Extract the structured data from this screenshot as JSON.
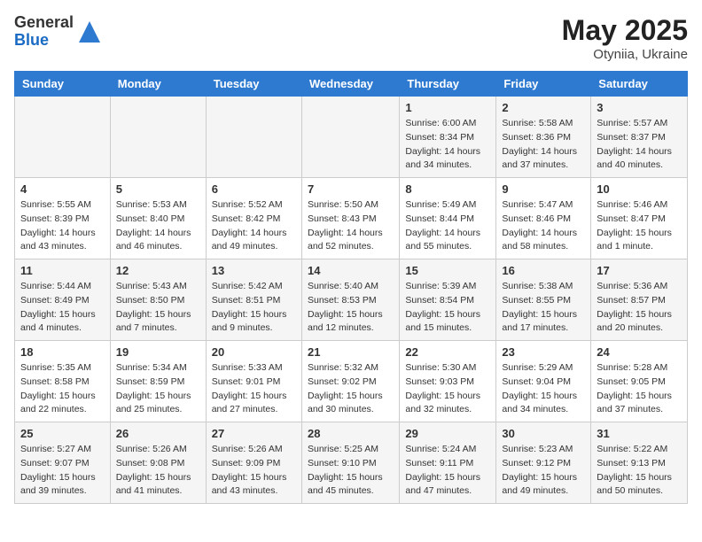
{
  "header": {
    "logo_general": "General",
    "logo_blue": "Blue",
    "month_title": "May 2025",
    "location": "Otyniia, Ukraine"
  },
  "weekdays": [
    "Sunday",
    "Monday",
    "Tuesday",
    "Wednesday",
    "Thursday",
    "Friday",
    "Saturday"
  ],
  "weeks": [
    [
      {
        "day": "",
        "info": ""
      },
      {
        "day": "",
        "info": ""
      },
      {
        "day": "",
        "info": ""
      },
      {
        "day": "",
        "info": ""
      },
      {
        "day": "1",
        "info": "Sunrise: 6:00 AM\nSunset: 8:34 PM\nDaylight: 14 hours\nand 34 minutes."
      },
      {
        "day": "2",
        "info": "Sunrise: 5:58 AM\nSunset: 8:36 PM\nDaylight: 14 hours\nand 37 minutes."
      },
      {
        "day": "3",
        "info": "Sunrise: 5:57 AM\nSunset: 8:37 PM\nDaylight: 14 hours\nand 40 minutes."
      }
    ],
    [
      {
        "day": "4",
        "info": "Sunrise: 5:55 AM\nSunset: 8:39 PM\nDaylight: 14 hours\nand 43 minutes."
      },
      {
        "day": "5",
        "info": "Sunrise: 5:53 AM\nSunset: 8:40 PM\nDaylight: 14 hours\nand 46 minutes."
      },
      {
        "day": "6",
        "info": "Sunrise: 5:52 AM\nSunset: 8:42 PM\nDaylight: 14 hours\nand 49 minutes."
      },
      {
        "day": "7",
        "info": "Sunrise: 5:50 AM\nSunset: 8:43 PM\nDaylight: 14 hours\nand 52 minutes."
      },
      {
        "day": "8",
        "info": "Sunrise: 5:49 AM\nSunset: 8:44 PM\nDaylight: 14 hours\nand 55 minutes."
      },
      {
        "day": "9",
        "info": "Sunrise: 5:47 AM\nSunset: 8:46 PM\nDaylight: 14 hours\nand 58 minutes."
      },
      {
        "day": "10",
        "info": "Sunrise: 5:46 AM\nSunset: 8:47 PM\nDaylight: 15 hours\nand 1 minute."
      }
    ],
    [
      {
        "day": "11",
        "info": "Sunrise: 5:44 AM\nSunset: 8:49 PM\nDaylight: 15 hours\nand 4 minutes."
      },
      {
        "day": "12",
        "info": "Sunrise: 5:43 AM\nSunset: 8:50 PM\nDaylight: 15 hours\nand 7 minutes."
      },
      {
        "day": "13",
        "info": "Sunrise: 5:42 AM\nSunset: 8:51 PM\nDaylight: 15 hours\nand 9 minutes."
      },
      {
        "day": "14",
        "info": "Sunrise: 5:40 AM\nSunset: 8:53 PM\nDaylight: 15 hours\nand 12 minutes."
      },
      {
        "day": "15",
        "info": "Sunrise: 5:39 AM\nSunset: 8:54 PM\nDaylight: 15 hours\nand 15 minutes."
      },
      {
        "day": "16",
        "info": "Sunrise: 5:38 AM\nSunset: 8:55 PM\nDaylight: 15 hours\nand 17 minutes."
      },
      {
        "day": "17",
        "info": "Sunrise: 5:36 AM\nSunset: 8:57 PM\nDaylight: 15 hours\nand 20 minutes."
      }
    ],
    [
      {
        "day": "18",
        "info": "Sunrise: 5:35 AM\nSunset: 8:58 PM\nDaylight: 15 hours\nand 22 minutes."
      },
      {
        "day": "19",
        "info": "Sunrise: 5:34 AM\nSunset: 8:59 PM\nDaylight: 15 hours\nand 25 minutes."
      },
      {
        "day": "20",
        "info": "Sunrise: 5:33 AM\nSunset: 9:01 PM\nDaylight: 15 hours\nand 27 minutes."
      },
      {
        "day": "21",
        "info": "Sunrise: 5:32 AM\nSunset: 9:02 PM\nDaylight: 15 hours\nand 30 minutes."
      },
      {
        "day": "22",
        "info": "Sunrise: 5:30 AM\nSunset: 9:03 PM\nDaylight: 15 hours\nand 32 minutes."
      },
      {
        "day": "23",
        "info": "Sunrise: 5:29 AM\nSunset: 9:04 PM\nDaylight: 15 hours\nand 34 minutes."
      },
      {
        "day": "24",
        "info": "Sunrise: 5:28 AM\nSunset: 9:05 PM\nDaylight: 15 hours\nand 37 minutes."
      }
    ],
    [
      {
        "day": "25",
        "info": "Sunrise: 5:27 AM\nSunset: 9:07 PM\nDaylight: 15 hours\nand 39 minutes."
      },
      {
        "day": "26",
        "info": "Sunrise: 5:26 AM\nSunset: 9:08 PM\nDaylight: 15 hours\nand 41 minutes."
      },
      {
        "day": "27",
        "info": "Sunrise: 5:26 AM\nSunset: 9:09 PM\nDaylight: 15 hours\nand 43 minutes."
      },
      {
        "day": "28",
        "info": "Sunrise: 5:25 AM\nSunset: 9:10 PM\nDaylight: 15 hours\nand 45 minutes."
      },
      {
        "day": "29",
        "info": "Sunrise: 5:24 AM\nSunset: 9:11 PM\nDaylight: 15 hours\nand 47 minutes."
      },
      {
        "day": "30",
        "info": "Sunrise: 5:23 AM\nSunset: 9:12 PM\nDaylight: 15 hours\nand 49 minutes."
      },
      {
        "day": "31",
        "info": "Sunrise: 5:22 AM\nSunset: 9:13 PM\nDaylight: 15 hours\nand 50 minutes."
      }
    ]
  ]
}
